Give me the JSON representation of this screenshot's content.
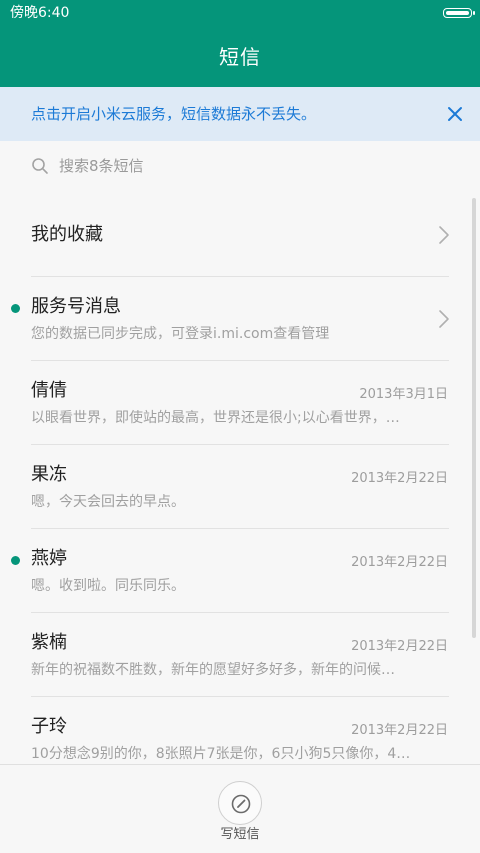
{
  "status_bar": {
    "time": "傍晚6:40"
  },
  "title": "短信",
  "banner": {
    "text": "点击开启小米云服务，短信数据永不丢失。"
  },
  "search": {
    "placeholder": "搜索8条短信"
  },
  "favorites": {
    "label": "我的收藏"
  },
  "conversations": [
    {
      "name": "服务号消息",
      "preview": "您的数据已同步完成，可登录i.mi.com查看管理",
      "date": "",
      "unread": true
    },
    {
      "name": "倩倩",
      "preview": "以眼看世界，即使站的最高，世界还是很小;以心看世界，…",
      "date": "2013年3月1日",
      "unread": false
    },
    {
      "name": "果冻",
      "preview": "嗯，今天会回去的早点。",
      "date": "2013年2月22日",
      "unread": false
    },
    {
      "name": "燕婷",
      "preview": "嗯。收到啦。同乐同乐。",
      "date": "2013年2月22日",
      "unread": true
    },
    {
      "name": "紫楠",
      "preview": "新年的祝福数不胜数，新年的愿望好多好多，新年的问候…",
      "date": "2013年2月22日",
      "unread": false
    },
    {
      "name": "子玲",
      "preview": "10分想念9别的你，8张照片7张是你，6只小狗5只像你，4…",
      "date": "2013年2月22日",
      "unread": false
    }
  ],
  "compose": {
    "label": "写短信"
  },
  "colors": {
    "primary": "#05957a",
    "banner_bg": "#deeaf6",
    "banner_text": "#1c7ad6"
  },
  "icons": {
    "banner_close": "close-icon",
    "search": "search-icon",
    "chevron": "chevron-right-icon",
    "compose": "compose-icon"
  }
}
